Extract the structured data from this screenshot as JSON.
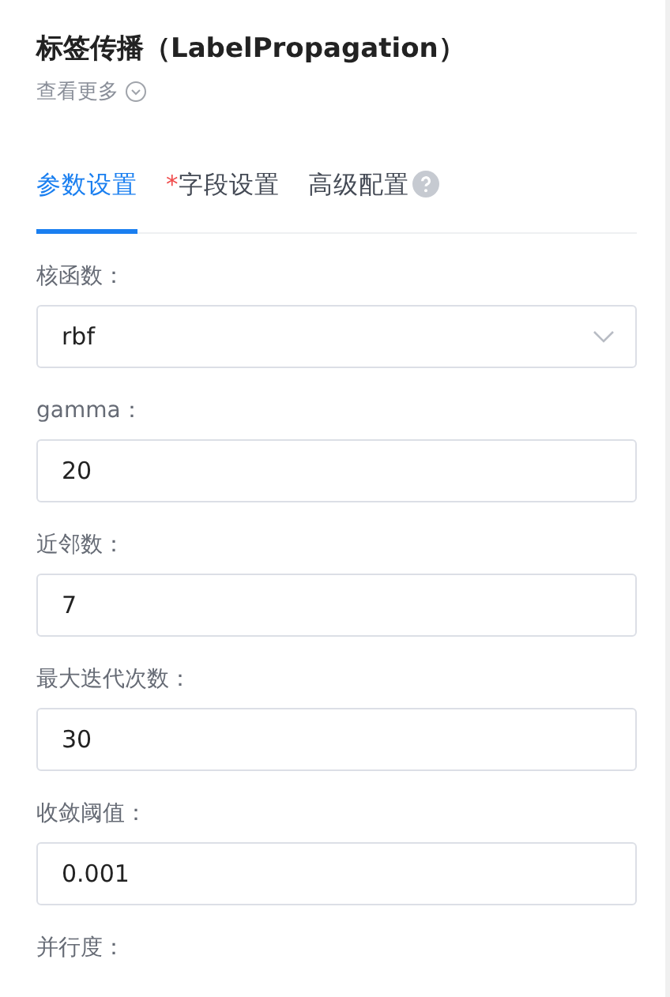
{
  "header": {
    "title": "标签传播（LabelPropagation）",
    "more_link": "查看更多"
  },
  "tabs": [
    {
      "label": "参数设置",
      "selected": true,
      "help": false
    },
    {
      "required_mark": "*",
      "label": "字段设置",
      "selected": false,
      "help": false
    },
    {
      "label": "高级配置",
      "selected": false,
      "help": true
    }
  ],
  "fields": [
    {
      "kind": "select",
      "label": "核函数：",
      "value": "rbf"
    },
    {
      "kind": "input",
      "label": "gamma：",
      "value": "20"
    },
    {
      "kind": "input",
      "label": "近邻数：",
      "value": "7"
    },
    {
      "kind": "input",
      "label": "最大迭代次数：",
      "value": "30"
    },
    {
      "kind": "input",
      "label": "收敛阈值：",
      "value": "0.001"
    },
    {
      "kind": "label",
      "label": "并行度："
    }
  ]
}
